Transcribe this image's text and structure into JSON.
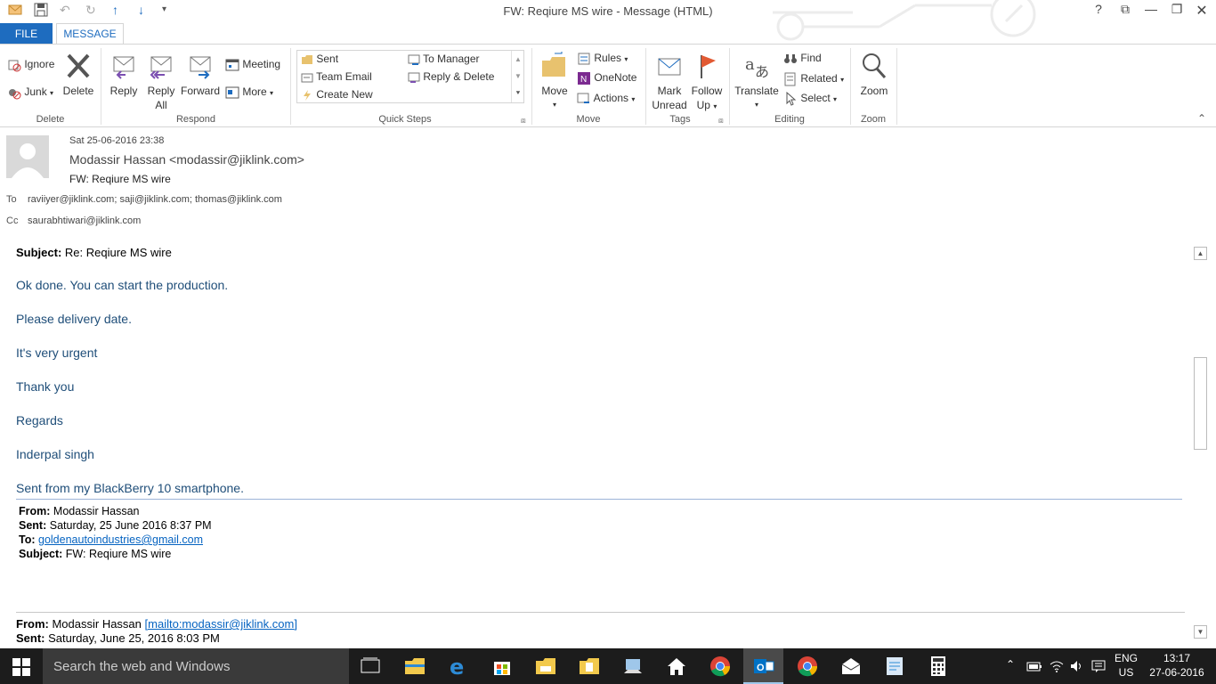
{
  "window": {
    "title": "FW: Reqiure MS wire - Message (HTML)"
  },
  "tabs": {
    "file": "FILE",
    "message": "MESSAGE"
  },
  "ribbon": {
    "delete_group": {
      "ignore": "Ignore",
      "junk": "Junk",
      "delete": "Delete",
      "label": "Delete"
    },
    "respond_group": {
      "reply": "Reply",
      "reply_all_1": "Reply",
      "reply_all_2": "All",
      "forward": "Forward",
      "meeting": "Meeting",
      "more": "More",
      "label": "Respond"
    },
    "quicksteps_group": {
      "items": [
        "Sent",
        "To Manager",
        "Team Email",
        "Reply & Delete",
        "Create New"
      ],
      "label": "Quick Steps"
    },
    "move_group": {
      "move": "Move",
      "rules": "Rules",
      "onenote": "OneNote",
      "actions": "Actions",
      "label": "Move"
    },
    "tags_group": {
      "mark_unread_1": "Mark",
      "mark_unread_2": "Unread",
      "follow_up_1": "Follow",
      "follow_up_2": "Up",
      "label": "Tags"
    },
    "editing_group": {
      "translate": "Translate",
      "find": "Find",
      "related": "Related",
      "select": "Select",
      "label": "Editing"
    },
    "zoom_group": {
      "zoom": "Zoom",
      "label": "Zoom"
    }
  },
  "header": {
    "date": "Sat 25-06-2016 23:38",
    "from": "Modassir Hassan <modassir@jiklink.com>",
    "subject": "FW: Reqiure MS wire",
    "to_label": "To",
    "to": "raviiyer@jiklink.com; saji@jiklink.com; thomas@jiklink.com",
    "cc_label": "Cc",
    "cc": "saurabhtiwari@jiklink.com"
  },
  "body": {
    "subject_label": "Subject:",
    "subject_value": "Re: Reqiure MS wire",
    "lines": [
      "Ok done. You can start the production.",
      "Please delivery date.",
      "It's very urgent",
      "Thank you",
      "Regards",
      "Inderpal singh",
      "Sent from my BlackBerry 10 smartphone."
    ],
    "fw1": {
      "from_label": "From:",
      "from": "Modassir Hassan",
      "sent_label": "Sent:",
      "sent": "Saturday, 25 June 2016 8:37 PM",
      "to_label": "To:",
      "to": "goldenautoindustries@gmail.com",
      "subject_label": "Subject:",
      "subject": "FW: Reqiure MS wire"
    },
    "fw2": {
      "from_label": "From:",
      "from": "Modassir Hassan",
      "mailto": "[mailto:modassir@jiklink.com]",
      "sent_label": "Sent:",
      "sent": "Saturday, June 25, 2016 8:03 PM"
    }
  },
  "taskbar": {
    "search_placeholder": "Search the web and Windows",
    "lang_1": "ENG",
    "lang_2": "US",
    "time": "13:17",
    "date": "27-06-2016"
  }
}
